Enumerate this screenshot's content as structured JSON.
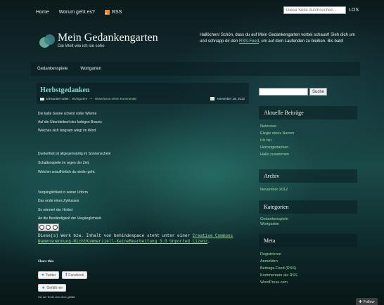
{
  "topnav": {
    "items": [
      "Home",
      "Worum geht es?",
      "RSS"
    ],
    "search_placeholder": "Diese Seite durchsuchen...",
    "search_button": "LOS"
  },
  "header": {
    "title": "Mein Gedankengarten",
    "tagline": "Die Welt wie ich sie sehe",
    "welcome_pre": "Hallöchen! Schön, dass du auf Mein Gedankengarten vorbei schaust! Sieh dich um und schnapp dir den ",
    "welcome_link": "RSS-Feed",
    "welcome_post": ", um auf dem Laufenden zu bleiben. Bis bald!"
  },
  "mainnav": {
    "items": [
      "Gedankenspiele",
      "Wortgarten"
    ]
  },
  "post": {
    "title": "Herbstgedanken",
    "meta_prefix": "Einsortiert unter:",
    "meta_category": "Wortgarten",
    "meta_sep": " — ",
    "meta_comment": "Hinterlasse einen Kommentar",
    "date": "November 18, 2012",
    "lines": [
      "Die kalte Sonne scheint voller Wärme",
      "Auf die Überbleibsel des farbigen Brauns",
      "Welches sich langsam wiegt im Wind",
      "Dunkelheit ist allgegenwärtig im Sonnenschein",
      "Schattenspiele im regen der Zeit,",
      "Welcher unaufhörlich da nieder geht.",
      "Vergänglichkeit in seiner Urform",
      "Das ende eines Zyklusses",
      "So erinnert der Herbst",
      "An die Beständigkeit der Vergänglichkeit."
    ],
    "license_pre": "Diese(s) Werk bzw. Inhalt von behindespace steht unter einer ",
    "license_link": "Creative Commons Namensnennung-NichtKommerziell-KeineBearbeitung 3.0 Unported Lizenz",
    "license_post": ".",
    "share_title": "Share this:",
    "share_twitter": "Twitter",
    "share_facebook": "Facebook",
    "like_label": "Gefällt mir",
    "like_note": "Sei der Erste dem dies gefällt."
  },
  "sidebar": {
    "search_button": "Suche",
    "recent_title": "Aktuelle Beiträge",
    "recent_items": [
      "Netzreise",
      "Elegie eines Narren",
      "Ich bin",
      "Herbstgedanken",
      "Hallo zusammen"
    ],
    "archive_title": "Archiv",
    "archive_items": [
      "November 2012"
    ],
    "categories_title": "Kategorien",
    "categories_items": [
      "Gedankenspiele",
      "Wortgarten"
    ],
    "meta_title": "Meta",
    "meta_items": [
      "Registrieren",
      "Anmelden",
      "Beitrags-Feed (RSS)",
      "Kommentare als RSS",
      "WordPress.com"
    ]
  },
  "follow_label": "Follow",
  "icons": [
    "rss-icon",
    "folder-icon",
    "calendar-icon",
    "twitter-icon",
    "facebook-icon",
    "star-icon",
    "creative-commons-icon",
    "follow-icon"
  ]
}
